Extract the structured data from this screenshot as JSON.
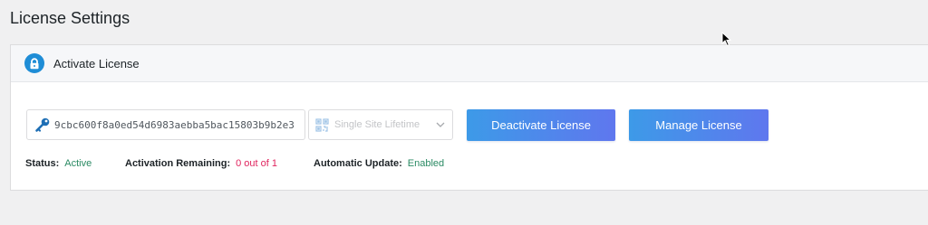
{
  "page": {
    "title": "License Settings"
  },
  "card": {
    "header_label": "Activate License",
    "license_key": "9cbc600f8a0ed54d6983aebba5bac15803b9b2e3",
    "plan": "Single Site Lifetime",
    "deactivate_label": "Deactivate License",
    "manage_label": "Manage License"
  },
  "status": {
    "status_label": "Status:",
    "status_value": "Active",
    "remaining_label": "Activation Remaining:",
    "remaining_value": "0 out of 1",
    "update_label": "Automatic Update:",
    "update_value": "Enabled"
  },
  "colors": {
    "accent": "#1f8dd6",
    "button_gradient_start": "#3d9ae8",
    "button_gradient_end": "#5f77ee",
    "status_active": "#2a8a63",
    "remaining": "#e0245e"
  },
  "icons": {
    "header": "lock-icon",
    "field": "key-icon",
    "plan": "qr-code-icon",
    "dropdown": "chevron-down-icon",
    "pointer": "mouse-cursor-icon"
  }
}
